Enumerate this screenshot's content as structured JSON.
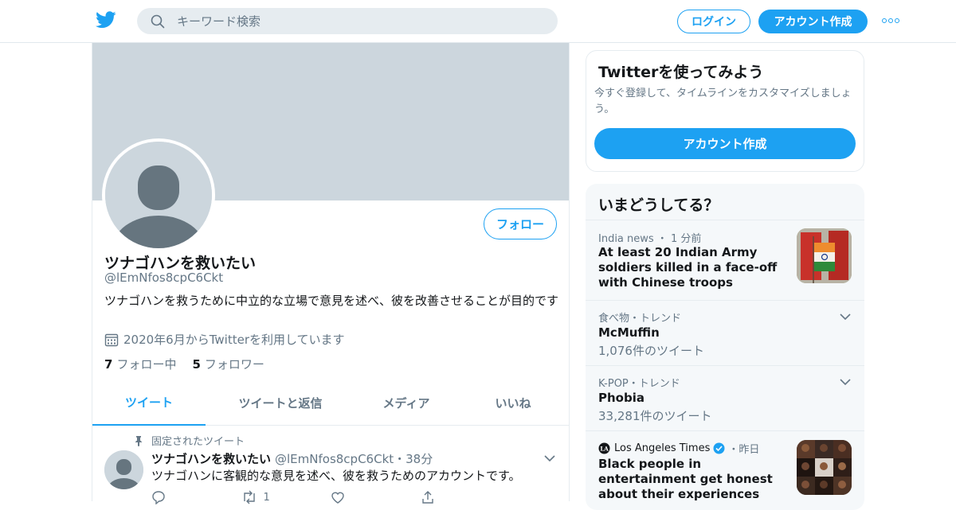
{
  "search": {
    "placeholder": "キーワード検索"
  },
  "header": {
    "login": "ログイン",
    "signup": "アカウント作成"
  },
  "profile": {
    "name": "ツナゴハンを救いたい",
    "handle": "@lEmNfos8cpC6Ckt",
    "bio": "ツナゴハンを救うために中立的な立場で意見を述べ、彼を改善させることが目的です",
    "joined": "2020年6月からTwitterを利用しています",
    "following_count": "7",
    "following_label": "フォロー中",
    "followers_count": "5",
    "followers_label": "フォロワー",
    "follow_button": "フォロー"
  },
  "tabs": [
    {
      "label": "ツイート"
    },
    {
      "label": "ツイートと返信"
    },
    {
      "label": "メディア"
    },
    {
      "label": "いいね"
    }
  ],
  "tweet": {
    "pinned_label": "固定されたツイート",
    "name": "ツナゴハンを救いたい",
    "handle_time": "@lEmNfos8cpC6Ckt・38分",
    "text": "ツナゴハンに客観的な意見を述べ、彼を救うためのアカウントです。",
    "retweets": "1"
  },
  "signup_card": {
    "title": "Twitterを使ってみよう",
    "subtitle": "今すぐ登録して、タイムラインをカスタマイズしましょう。",
    "button": "アカウント作成"
  },
  "trends": {
    "title": "いまどうしてる？",
    "items": [
      {
        "meta": "India news ・ 1 分前",
        "title": "At least 20 Indian Army soldiers killed in a face-off with Chinese troops"
      },
      {
        "meta": "食べ物・トレンド",
        "title": "McMuffin",
        "count": "1,076件のツイート"
      },
      {
        "meta": "K-POP・トレンド",
        "title": "Phobia",
        "count": "33,281件のツイート"
      },
      {
        "source": "Los Angeles Times",
        "time": "・昨日",
        "title": "Black people in entertainment get honest about their experiences"
      }
    ]
  },
  "colors": {
    "accent": "#1da1f2",
    "banner": "#ccd6dd",
    "muted": "#657786"
  }
}
